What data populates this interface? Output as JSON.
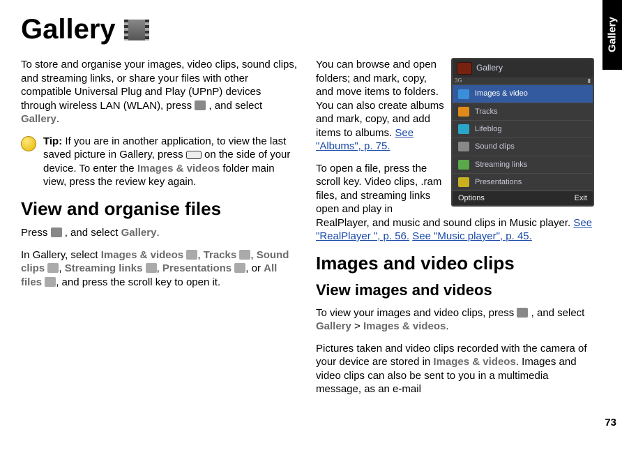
{
  "side_tab": "Gallery",
  "page_number": "73",
  "title": "Gallery",
  "intro": {
    "p1_a": "To store and organise your images, video clips, sound clips, and streaming links, or share your files with other compatible Universal Plug and Play (UPnP) devices through wireless LAN (WLAN), press ",
    "p1_b": " , and select ",
    "gallery": "Gallery",
    "p1_c": "."
  },
  "tip": {
    "label": "Tip:",
    "body_a": " If you are in another application, to view the last saved picture in Gallery, press ",
    "body_b": " on the side of your device. To enter the ",
    "images_videos": "Images & videos",
    "body_c": " folder main view, press the review key again."
  },
  "section_view": {
    "heading": "View and organise files",
    "p1_a": "Press ",
    "p1_b": " , and select ",
    "gallery": "Gallery",
    "p1_c": ".",
    "p2_a": "In Gallery, select ",
    "imgvid": "Images & videos",
    "sep1": ", ",
    "tracks": "Tracks",
    "sep2": ", ",
    "sound": "Sound clips",
    "sep3": ", ",
    "stream": "Streaming links",
    "sep4": ", ",
    "pres": "Presentations",
    "sep5": ", or ",
    "all": "All files",
    "p2_b": ", and press the scroll key to open it."
  },
  "col2": {
    "p1_a": "You can browse and open folders; and mark, copy, and move items to folders. You can also create albums and mark, copy, and add items to albums. ",
    "link_albums": "See \"Albums\", p. 75.",
    "p2_a": "To open a file, press the scroll key. Video clips, .ram files, and streaming links open and play in RealPlayer, and music and sound clips in Music player. ",
    "link_real": "See \"RealPlayer \", p. 56.",
    "sp": " ",
    "link_music": "See \"Music player\", p. 45."
  },
  "section_imgvid": {
    "heading": "Images and video clips",
    "subheading": "View images and videos",
    "p1_a": "To view your images and video clips, press ",
    "p1_b": " , and select ",
    "gallery": "Gallery",
    "gt": "  >  ",
    "imgvid": "Images & videos",
    "p1_c": ".",
    "p2_a": "Pictures taken and video clips recorded with the camera of your device are stored in ",
    "imgvid2": "Images & videos",
    "p2_b": ". Images and video clips can also be sent to you in a multimedia message, as an e-mail"
  },
  "phone": {
    "title": "Gallery",
    "status_left": "3G",
    "items": [
      {
        "label": "Images & video",
        "selected": true,
        "icon": "pi-blue"
      },
      {
        "label": "Tracks",
        "selected": false,
        "icon": "pi-orange"
      },
      {
        "label": "Lifeblog",
        "selected": false,
        "icon": "pi-cyan"
      },
      {
        "label": "Sound clips",
        "selected": false,
        "icon": "pi-gray"
      },
      {
        "label": "Streaming links",
        "selected": false,
        "icon": "pi-green"
      },
      {
        "label": "Presentations",
        "selected": false,
        "icon": "pi-yellow"
      }
    ],
    "softkey_left": "Options",
    "softkey_right": "Exit"
  }
}
